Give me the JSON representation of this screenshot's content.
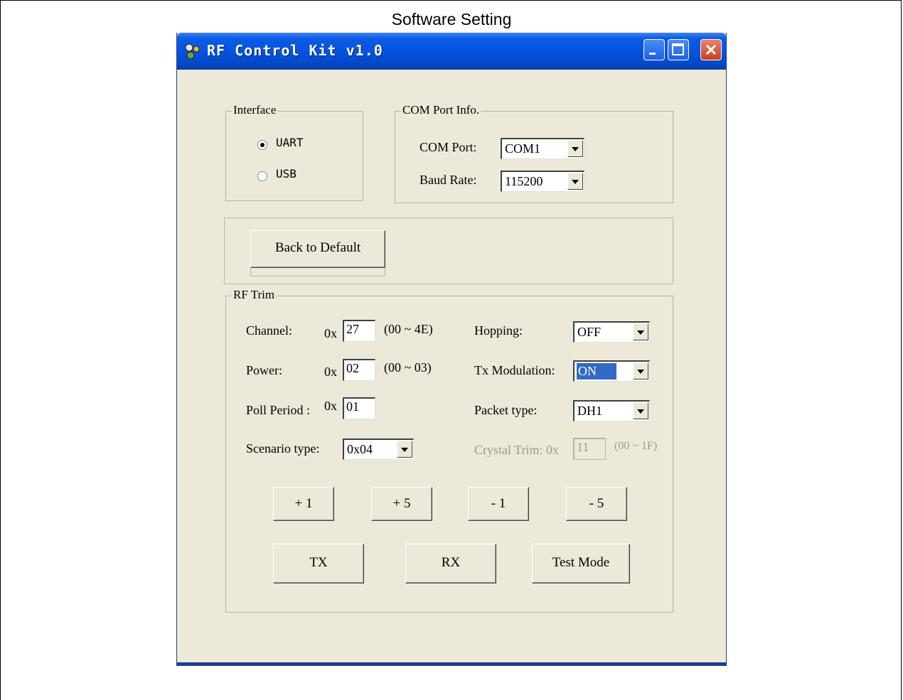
{
  "page_caption": "Software Setting",
  "window": {
    "title": "RF Control Kit v1.0",
    "controls": [
      "minimize-icon",
      "maximize-icon",
      "close-icon"
    ]
  },
  "interface_group": {
    "label": "Interface",
    "options": [
      {
        "label": "UART",
        "checked": true
      },
      {
        "label": "USB",
        "checked": false
      }
    ]
  },
  "com_group": {
    "label": "COM Port Info.",
    "com_port_label": "COM Port:",
    "com_port_value": "COM1",
    "baud_rate_label": "Baud Rate:",
    "baud_rate_value": "115200"
  },
  "default_group": {
    "button_label": "Back to Default"
  },
  "rf_trim": {
    "label": "RF Trim",
    "channel_label": "Channel:",
    "channel_prefix": "0x",
    "channel_value": "27",
    "channel_range": "(00 ~ 4E)",
    "power_label": "Power:",
    "power_prefix": "0x",
    "power_value": "02",
    "power_range": "(00 ~ 03)",
    "poll_label": "Poll Period :",
    "poll_prefix": "0x",
    "poll_value": "01",
    "scenario_label": "Scenario type:",
    "scenario_value": "0x04",
    "hopping_label": "Hopping:",
    "hopping_value": "OFF",
    "txmod_label": "Tx Modulation:",
    "txmod_value": "ON",
    "packet_label": "Packet type:",
    "packet_value": "DH1",
    "crystal_label": "Crystal Trim: 0x",
    "crystal_value": "11",
    "crystal_range": "(00 ~ 1F)",
    "step_buttons": [
      "+ 1",
      "+ 5",
      "- 1",
      "- 5"
    ],
    "tx_label": "TX",
    "rx_label": "RX",
    "test_mode_label": "Test Mode"
  }
}
